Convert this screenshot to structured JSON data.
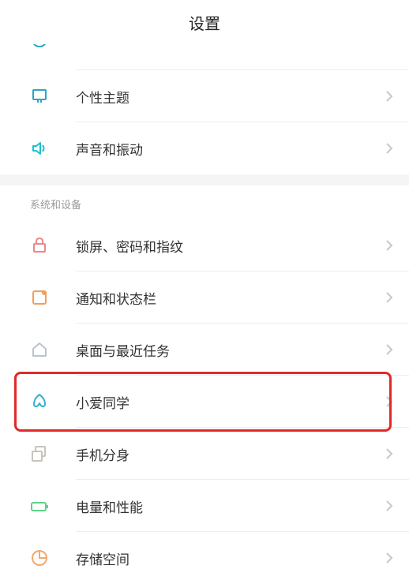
{
  "header": {
    "title": "设置"
  },
  "group1": {
    "items": [
      {
        "label": "个性主题",
        "icon": "theme-icon",
        "color": "#2aa6c5"
      },
      {
        "label": "声音和振动",
        "icon": "sound-icon",
        "color": "#1fbfd0"
      }
    ]
  },
  "group2": {
    "header": "系统和设备",
    "items": [
      {
        "label": "锁屏、密码和指纹",
        "icon": "lock-icon",
        "color": "#e88a8a"
      },
      {
        "label": "通知和状态栏",
        "icon": "notification-icon",
        "color": "#f0a05a"
      },
      {
        "label": "桌面与最近任务",
        "icon": "home-icon",
        "color": "#bcc3cc"
      },
      {
        "label": "小爱同学",
        "icon": "xiaoai-icon",
        "color": "#36b3c9"
      },
      {
        "label": "手机分身",
        "icon": "clone-icon",
        "color": "#c9c3bc"
      },
      {
        "label": "电量和性能",
        "icon": "battery-icon",
        "color": "#5fd08a"
      },
      {
        "label": "存储空间",
        "icon": "storage-icon",
        "color": "#f2a96b"
      }
    ]
  }
}
